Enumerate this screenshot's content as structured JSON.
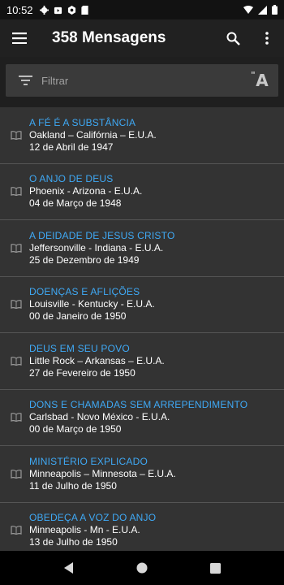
{
  "status_bar": {
    "time": "10:52",
    "left_icons": [
      "gear-icon",
      "playstore-icon",
      "gear-icon",
      "sd-card-icon"
    ],
    "right_icons": [
      "wifi-icon",
      "signal-icon",
      "battery-icon"
    ]
  },
  "app_bar": {
    "title": "358 Mensagens",
    "menu_icon": "hamburger-menu-icon",
    "search_icon": "search-icon",
    "overflow_icon": "more-vert-icon"
  },
  "filter": {
    "placeholder": "Filtrar",
    "value": "",
    "font_toggle_label": "A"
  },
  "colors": {
    "title_blue": "#3fa9f5",
    "background": "#1f1f1f",
    "item_background": "#333333"
  },
  "messages": [
    {
      "title": "A FÉ É A SUBSTÂNCIA",
      "place": "Oakland – Califórnia – E.U.A.",
      "date": "12 de Abril de 1947"
    },
    {
      "title": "O ANJO DE DEUS",
      "place": "Phoenix - Arizona - E.U.A.",
      "date": "04 de Março de 1948"
    },
    {
      "title": "A DEIDADE DE JESUS CRISTO",
      "place": "Jeffersonville - Indiana - E.U.A.",
      "date": "25 de Dezembro de 1949"
    },
    {
      "title": "DOENÇAS E AFLIÇÕES",
      "place": "Louisville - Kentucky - E.U.A.",
      "date": "00 de Janeiro de 1950"
    },
    {
      "title": "DEUS EM SEU POVO",
      "place": "Little Rock – Arkansas – E.U.A.",
      "date": "27 de Fevereiro de 1950"
    },
    {
      "title": "DONS E CHAMADAS SEM ARREPENDIMENTO",
      "place": "Carlsbad - Novo México - E.U.A.",
      "date": "00 de Março de 1950"
    },
    {
      "title": "MINISTÉRIO EXPLICADO",
      "place": "Minneapolis – Minnesota – E.U.A.",
      "date": "11 de Julho de 1950"
    },
    {
      "title": "OBEDEÇA A VOZ DO ANJO",
      "place": "Minneapolis - Mn - E.U.A.",
      "date": "13 de Julho de 1950"
    }
  ],
  "nav_bar": {
    "buttons": [
      "back-icon",
      "home-icon",
      "recents-icon"
    ]
  }
}
